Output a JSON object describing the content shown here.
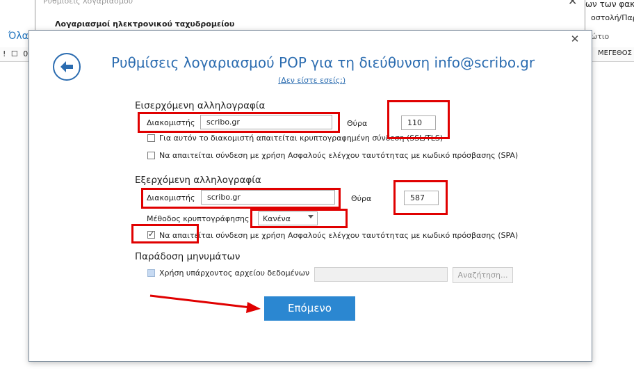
{
  "background": {
    "olh_text": "Όλα",
    "column_icons": "! ☐ 0 |",
    "right_text_1": "ων των φακέ",
    "right_text_2": "οστολή/Παραλ",
    "right_text_3": "ώτιο",
    "right_column_header": "ΜΕΓΕΘΟΣ"
  },
  "behind_dialog": {
    "title": "Ρυθμίσεις λογαριασμού",
    "subtitle": "Λογαριασμοί ηλεκτρονικού ταχυδρομείου",
    "close": "✕"
  },
  "dialog": {
    "close": "✕",
    "title": "Ρυθμίσεις λογαριασμού POP για τη διεύθυνση info@scribo.gr",
    "not_you": "(Δεν είστε εσείς;)",
    "incoming": {
      "heading": "Εισερχόμενη αλληλογραφία",
      "server_label": "Διακομιστής",
      "server_value": "scribo.gr",
      "port_label": "Θύρα",
      "port_value": "110",
      "ssl_label": "Για αυτόν το διακομιστή απαιτείται κρυπτογραφημένη σύνδεση (SSL/TLS)",
      "ssl_checked": false,
      "spa_label": "Να απαιτείται σύνδεση με χρήση Ασφαλούς ελέγχου ταυτότητας με κωδικό πρόσβασης (SPA)",
      "spa_checked": false
    },
    "outgoing": {
      "heading": "Εξερχόμενη αλληλογραφία",
      "server_label": "Διακομιστής",
      "server_value": "scribo.gr",
      "port_label": "Θύρα",
      "port_value": "587",
      "encryption_label": "Μέθοδος κρυπτογράφησης",
      "encryption_value": "Κανένα",
      "spa_label": "Να απαιτείται σύνδεση με χρήση Ασφαλούς ελέγχου ταυτότητας με κωδικό πρόσβασης (SPA)",
      "spa_checked": true
    },
    "delivery": {
      "heading": "Παράδοση μηνυμάτων",
      "existing_file_label": "Χρήση υπάρχοντος αρχείου δεδομένων",
      "existing_file_checked": false,
      "browse_label": "Αναζήτηση..."
    },
    "next_label": "Επόμενο"
  },
  "colors": {
    "accent": "#2b6cb0",
    "primary_button": "#2b87d1",
    "highlight_red": "#e00000"
  }
}
